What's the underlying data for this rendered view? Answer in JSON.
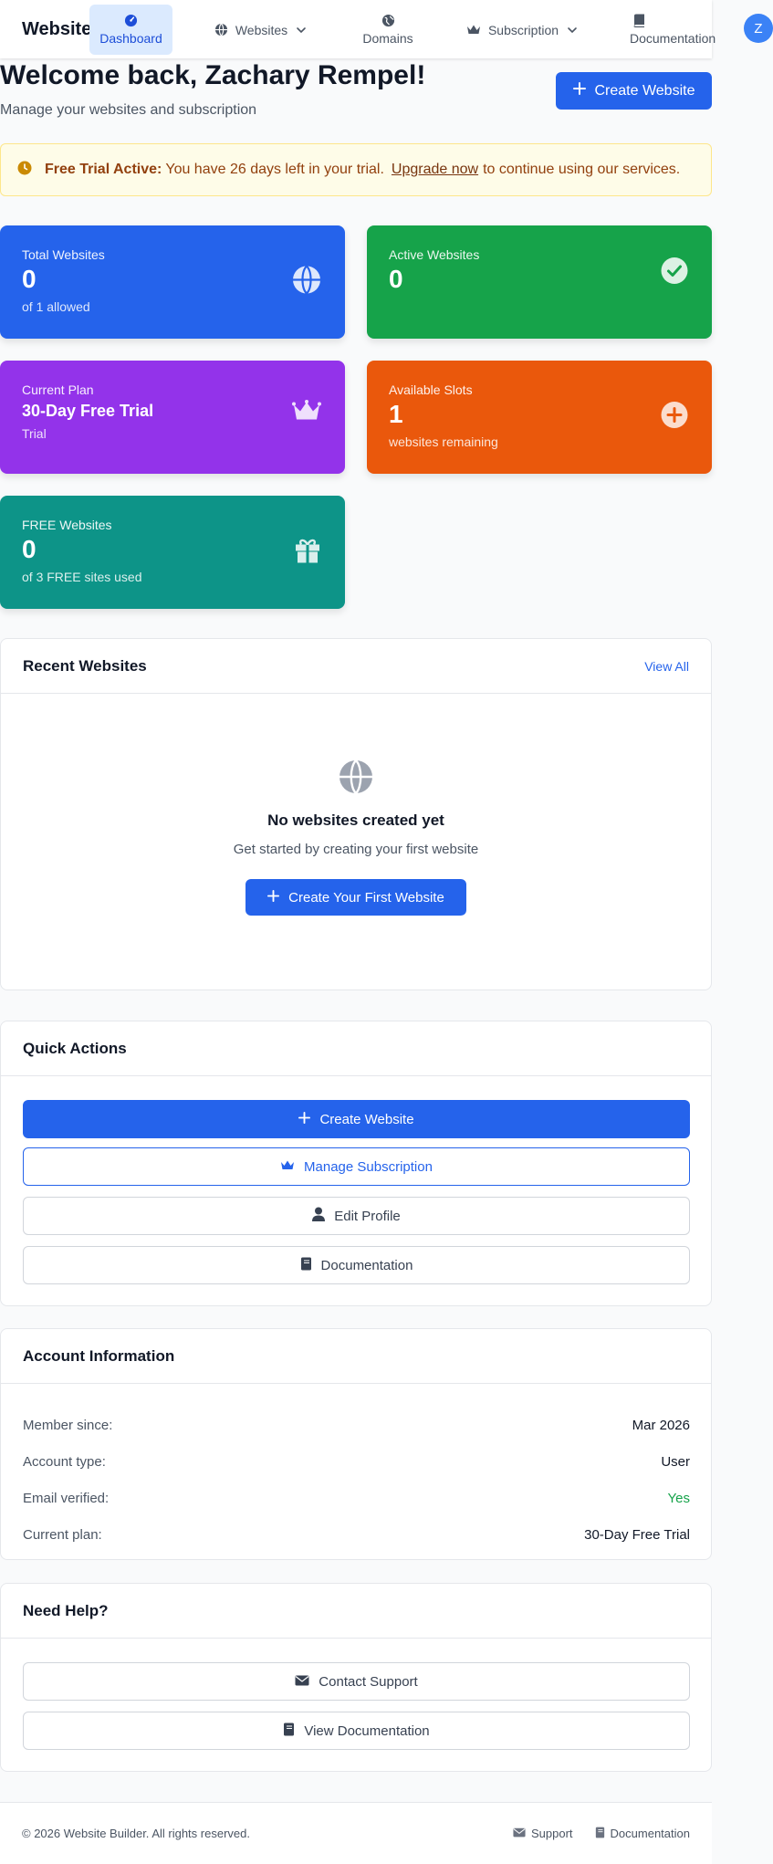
{
  "nav": {
    "brand": "Website",
    "items": [
      {
        "label": "Dashboard",
        "icon": "gauge-icon"
      },
      {
        "label": "Websites",
        "icon": "globe-icon"
      },
      {
        "label": "Domains",
        "icon": "globe-alt-icon"
      },
      {
        "label": "Subscription",
        "icon": "crown-icon"
      },
      {
        "label": "Documentation",
        "icon": "book-icon"
      }
    ],
    "avatar_initial": "Z"
  },
  "header": {
    "title": "Welcome back, Zachary Rempel!",
    "subtitle": "Manage your websites and subscription",
    "create_button": "Create Website"
  },
  "trial": {
    "label": "Free Trial Active:",
    "message": "You have 26 days left in your trial.",
    "link": "Upgrade now",
    "suffix": "to continue using our services."
  },
  "stats": {
    "total": {
      "label": "Total Websites",
      "value": "0",
      "sub": "of 1 allowed"
    },
    "active": {
      "label": "Active Websites",
      "value": "0"
    },
    "plan": {
      "label": "Current Plan",
      "value": "30-Day Free Trial",
      "sub": "Trial"
    },
    "slots": {
      "label": "Available Slots",
      "value": "1",
      "sub": "websites remaining"
    },
    "free": {
      "label": "FREE Websites",
      "value": "0",
      "sub": "of 3 FREE sites used"
    }
  },
  "recent": {
    "title": "Recent Websites",
    "view_all": "View All",
    "empty_title": "No websites created yet",
    "empty_sub": "Get started by creating your first website",
    "empty_button": "Create Your First Website"
  },
  "quick_actions": {
    "title": "Quick Actions",
    "create": "Create Website",
    "manage": "Manage Subscription",
    "profile": "Edit Profile",
    "docs": "Documentation"
  },
  "account": {
    "title": "Account Information",
    "rows": [
      {
        "key": "Member since:",
        "value": "Mar 2026"
      },
      {
        "key": "Account type:",
        "value": "User"
      },
      {
        "key": "Email verified:",
        "value": "Yes"
      },
      {
        "key": "Current plan:",
        "value": "30-Day Free Trial"
      }
    ]
  },
  "help": {
    "title": "Need Help?",
    "contact": "Contact Support",
    "docs": "View Documentation"
  },
  "footer": {
    "copyright": "© 2026 Website Builder. All rights reserved.",
    "support": "Support",
    "docs": "Documentation"
  },
  "colors": {
    "primary": "#2563eb",
    "success": "#16a34a",
    "purple": "#9333ea",
    "orange": "#ea580c",
    "teal": "#0d9488",
    "warning_bg": "#fefce8"
  }
}
